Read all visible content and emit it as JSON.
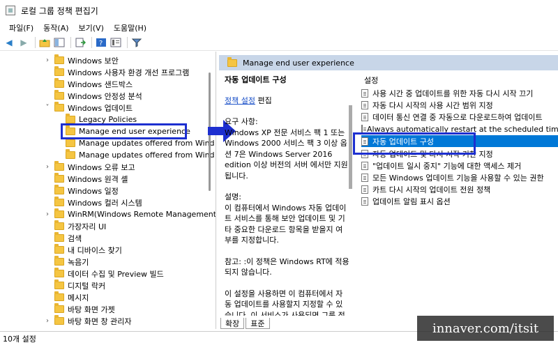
{
  "window": {
    "title": "로컬 그룹 정책 편집기"
  },
  "menu": [
    "파일(F)",
    "동작(A)",
    "보기(V)",
    "도움말(H)"
  ],
  "toolbar": {
    "icons": [
      "back-arrow-icon",
      "forward-arrow-icon",
      "folder-up-icon",
      "show-tree-icon",
      "export-icon",
      "help-icon",
      "properties-icon",
      "filter-icon"
    ]
  },
  "tree": [
    {
      "label": "Windows 보안",
      "chevron": "›",
      "indent": 1
    },
    {
      "label": "Windows 사용자 환경 개선 프로그램",
      "chevron": "",
      "indent": 1
    },
    {
      "label": "Windows 샌드박스",
      "chevron": "",
      "indent": 1
    },
    {
      "label": "Windows 안정성 분석",
      "chevron": "",
      "indent": 1
    },
    {
      "label": "Windows 업데이트",
      "chevron": "˅",
      "indent": 1
    },
    {
      "label": "Legacy Policies",
      "chevron": "",
      "indent": 2
    },
    {
      "label": "Manage end user experience",
      "chevron": "",
      "indent": 2
    },
    {
      "label": "Manage updates offered from Wind",
      "chevron": "",
      "indent": 2
    },
    {
      "label": "Manage updates offered from Wind",
      "chevron": "",
      "indent": 2
    },
    {
      "label": "Windows 오류 보고",
      "chevron": "›",
      "indent": 1
    },
    {
      "label": "Windows 원격 셸",
      "chevron": "",
      "indent": 1
    },
    {
      "label": "Windows 일정",
      "chevron": "",
      "indent": 1
    },
    {
      "label": "Windows 컬러 시스템",
      "chevron": "",
      "indent": 1
    },
    {
      "label": "WinRM(Windows Remote Management",
      "chevron": "›",
      "indent": 1
    },
    {
      "label": "가장자리 UI",
      "chevron": "",
      "indent": 1
    },
    {
      "label": "검색",
      "chevron": "",
      "indent": 1
    },
    {
      "label": "내 디바이스 찾기",
      "chevron": "",
      "indent": 1
    },
    {
      "label": "녹음기",
      "chevron": "",
      "indent": 1
    },
    {
      "label": "데이터 수집 및 Preview 빌드",
      "chevron": "",
      "indent": 1
    },
    {
      "label": "디지털 락커",
      "chevron": "",
      "indent": 1
    },
    {
      "label": "메시지",
      "chevron": "",
      "indent": 1
    },
    {
      "label": "바탕 화면 가젯",
      "chevron": "",
      "indent": 1
    },
    {
      "label": "바탕 화면 창 관리자",
      "chevron": "›",
      "indent": 1
    }
  ],
  "right_header": "Manage end user experience",
  "description": {
    "title": "자동 업데이트 구성",
    "edit_link": "정책 설정",
    "edit_suffix": " 편집",
    "requirements": "요구 사항:\nWindows XP 전문 서비스 팩 1 또는 Windows 2000 서비스 팩 3 이상 옵션 7은 Windows Server 2016 edition 이상 버전의 서버 에서만 지원됩니다.",
    "explanation": "설명:\n이 컴퓨터에서 Windows 자동 업데이트 서비스를 통해 보안 업데이트 및 기타 중요한 다운로드 항목을 받을지 여부를 지정합니다.",
    "note": "참고: :이 정책은 Windows RT에 적용되지 않습니다.",
    "usage": "이 설정을 사용하면 이 컴퓨터에서 자동 업데이트를 사용할지 지정할 수 있습니다. 이 서비스가 사용되면 그룹 정책 설정에서 다음 네 가지 옵션 중 하나를 선택해야 합"
  },
  "settings": {
    "header": "설정",
    "items": [
      "사용 시간 중 업데이트를 위한 자동 다시 시작 끄기",
      "자동 다시 시작의 사용 시간 범위 지정",
      "데이터 통신 연결 중 자동으로 다운로드하여 업데이트",
      "Always automatically restart at the scheduled time(할",
      "자동 업데이트 구성",
      "자동 업데이트 및 다시 시작 기한 지정",
      "\"업데이트 일시 중지\" 기능에 대한 액세스 제거",
      "모든 Windows 업데이트 기능을 사용할 수 있는 권한",
      "카트 다시 시작의 업데이트 전원 정책",
      "업데이트 알림 표시 옵션"
    ],
    "selected_index": 4
  },
  "tabs": [
    "확장",
    "표준"
  ],
  "status": "10개 설정",
  "watermark": "innaver.com/itsit",
  "colors": {
    "highlight_box": "#1d2fd0",
    "selection": "#0078d7",
    "header_bg": "#c8d6e8"
  }
}
